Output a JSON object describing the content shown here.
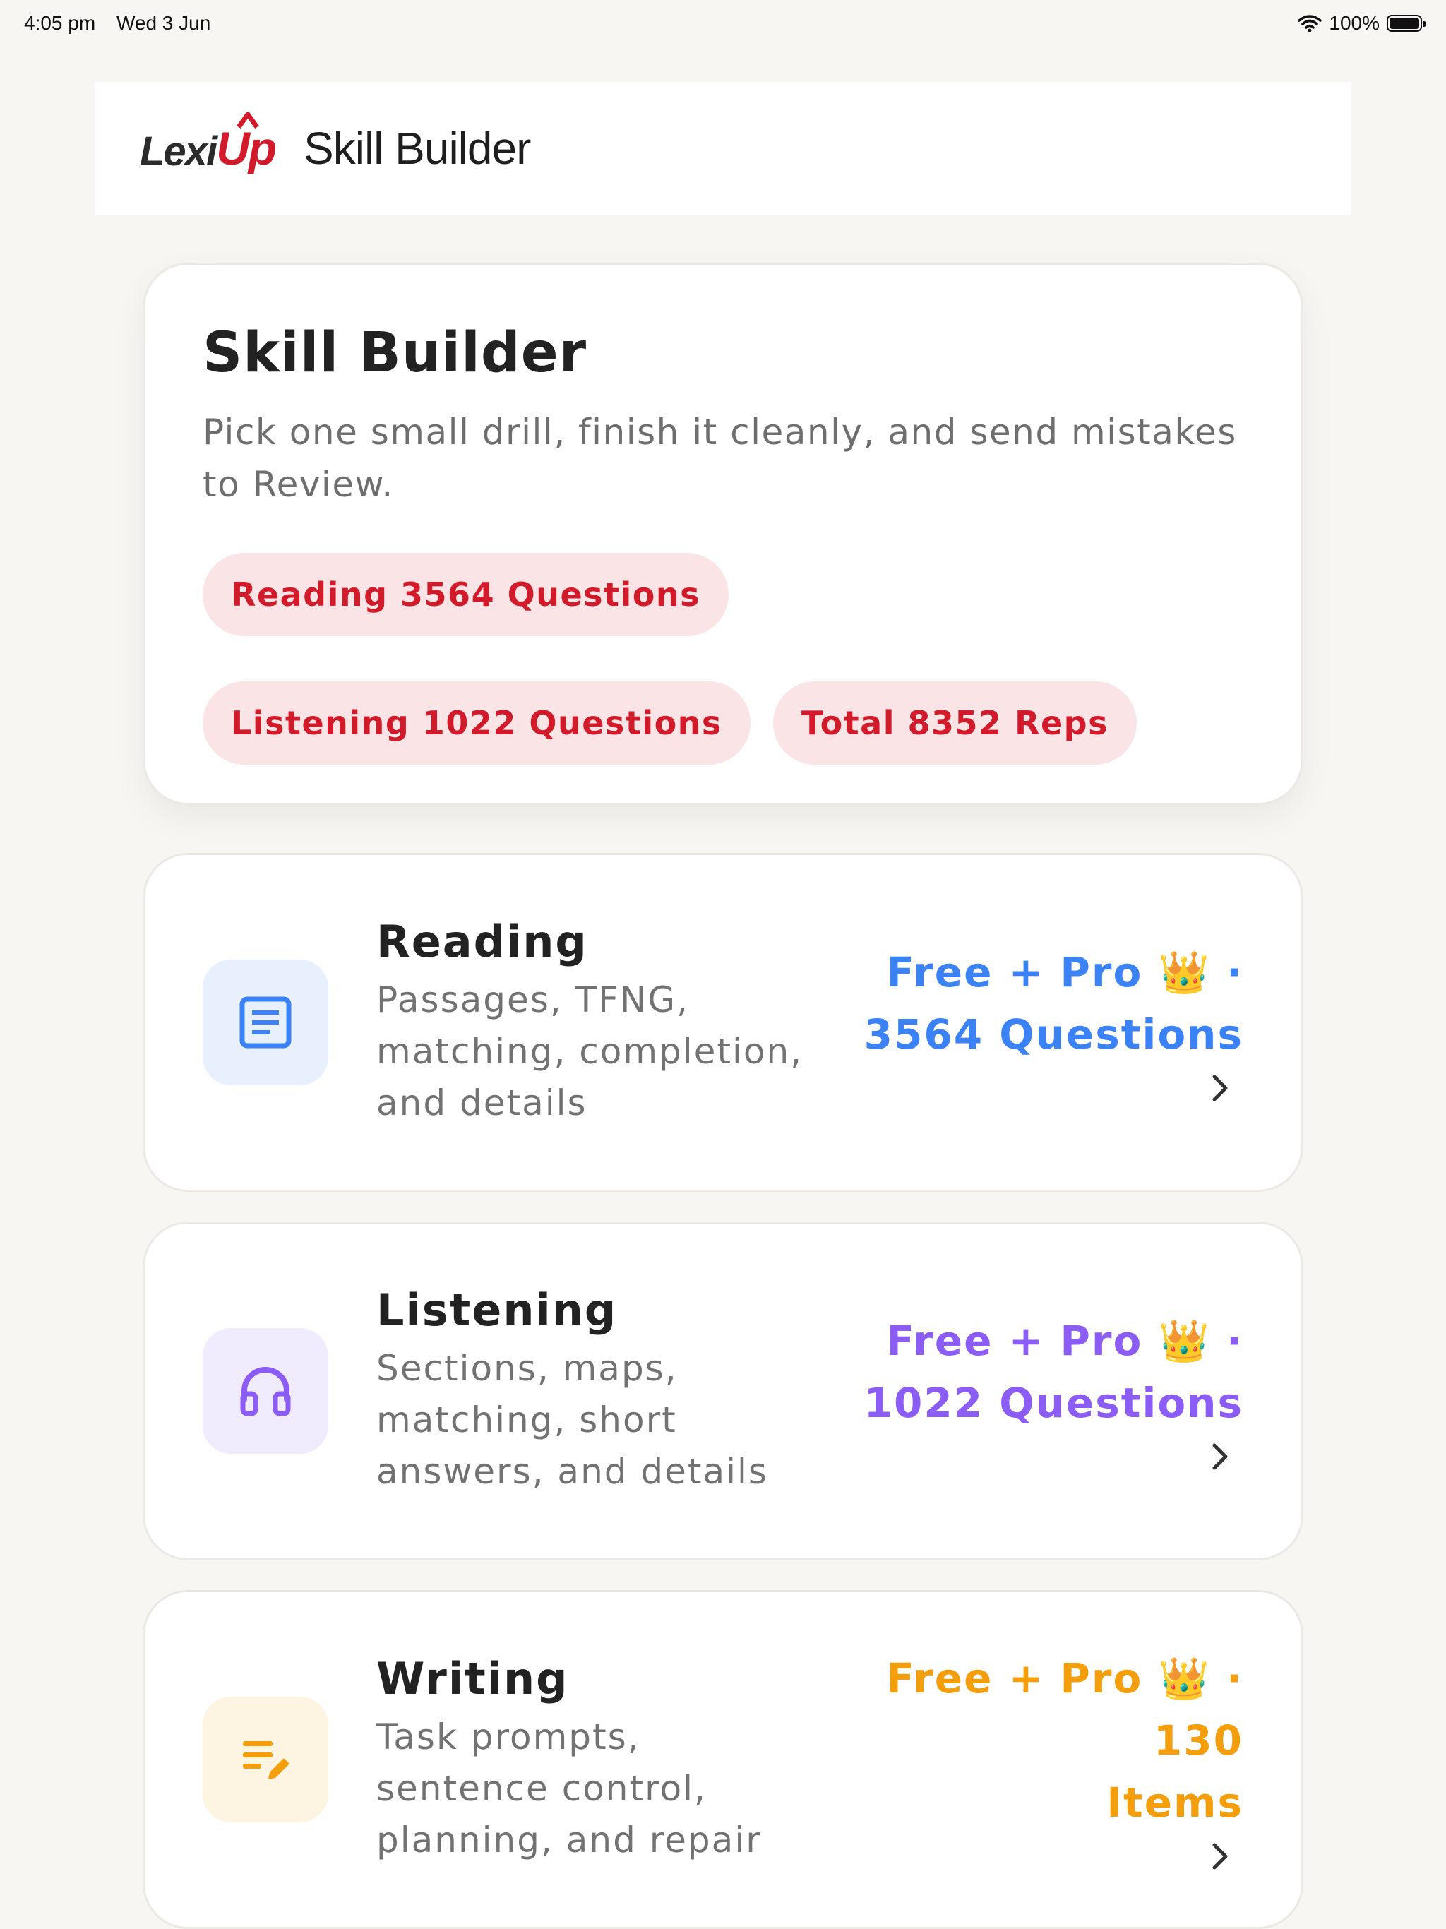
{
  "status_bar": {
    "time": "4:05 pm",
    "date": "Wed 3 Jun",
    "battery": "100%"
  },
  "header": {
    "logo_text_a": "Lexi",
    "logo_text_b": "Up",
    "title": "Skill Builder"
  },
  "hero": {
    "title": "Skill Builder",
    "subtitle": "Pick one small drill, finish it cleanly, and send mistakes to Review.",
    "chips": [
      "Reading 3564 Questions",
      "Listening 1022 Questions",
      "Total 8352 Reps"
    ]
  },
  "skills": [
    {
      "name": "Reading",
      "desc_lines": [
        "Passages, TFNG,",
        "matching, completion,",
        "and details"
      ],
      "meta_lines": [
        "Free + Pro 👑 ·",
        "3564 Questions"
      ],
      "color": "#3b82f6",
      "bg": "#e8f0fd",
      "icon": "article-icon"
    },
    {
      "name": "Listening",
      "desc_lines": [
        "Sections, maps,",
        "matching, short",
        "answers, and details"
      ],
      "meta_lines": [
        "Free + Pro 👑 ·",
        "1022 Questions"
      ],
      "color": "#8b5cf6",
      "bg": "#f1ecfd",
      "icon": "headphones-icon"
    },
    {
      "name": "Writing",
      "desc_lines": [
        "Task prompts,",
        "sentence control,",
        "planning, and repair"
      ],
      "meta_lines": [
        "Free + Pro 👑 · 130",
        "Items"
      ],
      "color": "#f59e0b",
      "bg": "#fef4e2",
      "icon": "edit-note-icon"
    }
  ]
}
